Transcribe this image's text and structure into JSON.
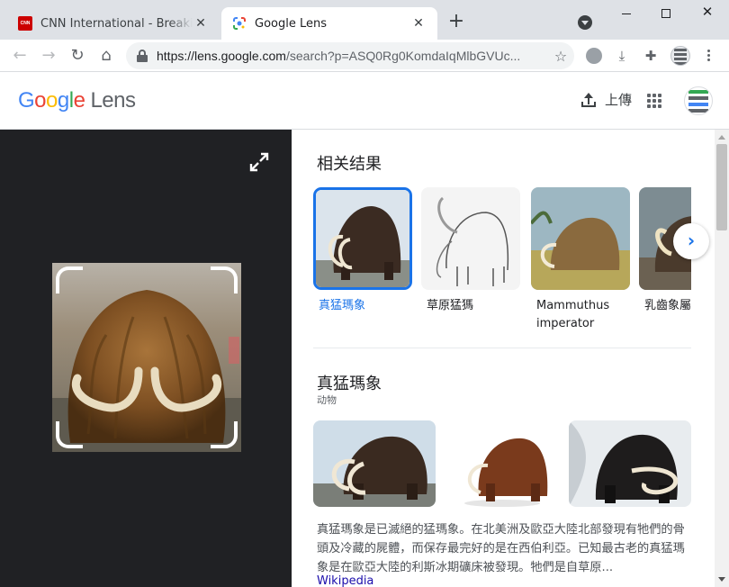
{
  "browser": {
    "tabs": [
      {
        "title": "CNN International - Breaking News",
        "favicon": "cnn-logo",
        "favicon_text": "CNN",
        "active": false
      },
      {
        "title": "Google Lens",
        "favicon": "google-lens-logo",
        "active": true
      }
    ],
    "new_tab_symbol": "+",
    "address_bar": {
      "host": "https://lens.google.com",
      "path": "/search?p=ASQ0Rg0KomdaIqMlbGVUc..."
    }
  },
  "lens": {
    "logo": {
      "letters": [
        "G",
        "o",
        "o",
        "g",
        "l",
        "e"
      ],
      "product": "Lens"
    },
    "upload_label": "上傳",
    "related_title": "相关结果",
    "related": [
      {
        "label": "真猛瑪象",
        "selected": true
      },
      {
        "label": "草原猛獁",
        "selected": false
      },
      {
        "label": "Mammuthus imperator",
        "selected": false
      },
      {
        "label": "乳齒象屬",
        "selected": false
      }
    ],
    "carousel_next": "›",
    "entity": {
      "title": "真猛瑪象",
      "subtitle": "动物",
      "description": "真猛瑪象是已滅絕的猛瑪象。在北美洲及歐亞大陸北部發現有牠們的骨頭及冷藏的屍體，而保存最完好的是在西伯利亞。已知最古老的真猛瑪象是在歐亞大陸的利斯冰期礦床被發現。牠們是自草原...",
      "source": "Wikipedia"
    }
  },
  "colors": {
    "accent": "#1a73e8",
    "left_panel_bg": "#202124",
    "link": "#1a0dab"
  }
}
